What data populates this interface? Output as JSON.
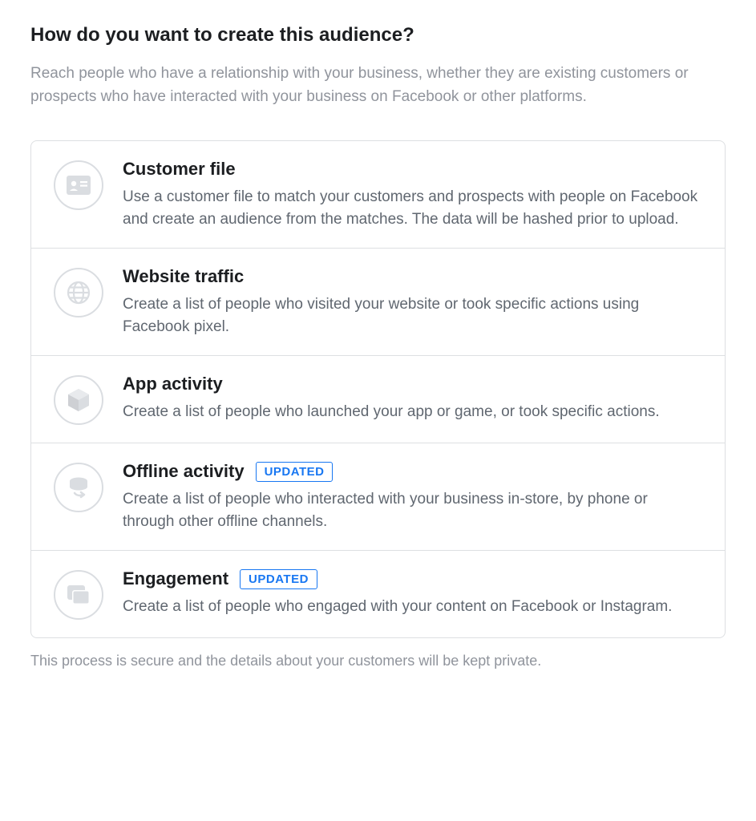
{
  "heading": "How do you want to create this audience?",
  "description": "Reach people who have a relationship with your business, whether they are existing customers or prospects who have interacted with your business on Facebook or other platforms.",
  "options": [
    {
      "icon": "contact-card-icon",
      "title": "Customer file",
      "badge": null,
      "desc": "Use a customer file to match your customers and prospects with people on Facebook and create an audience from the matches. The data will be hashed prior to upload."
    },
    {
      "icon": "globe-icon",
      "title": "Website traffic",
      "badge": null,
      "desc": "Create a list of people who visited your website or took specific actions using Facebook pixel."
    },
    {
      "icon": "cube-icon",
      "title": "App activity",
      "badge": null,
      "desc": "Create a list of people who launched your app or game, or took specific actions."
    },
    {
      "icon": "database-sync-icon",
      "title": "Offline activity",
      "badge": "UPDATED",
      "desc": "Create a list of people who interacted with your business in-store, by phone or through other offline channels."
    },
    {
      "icon": "stack-icon",
      "title": "Engagement",
      "badge": "UPDATED",
      "desc": "Create a list of people who engaged with your content on Facebook or Instagram."
    }
  ],
  "footer": "This process is secure and the details about your customers will be kept private."
}
